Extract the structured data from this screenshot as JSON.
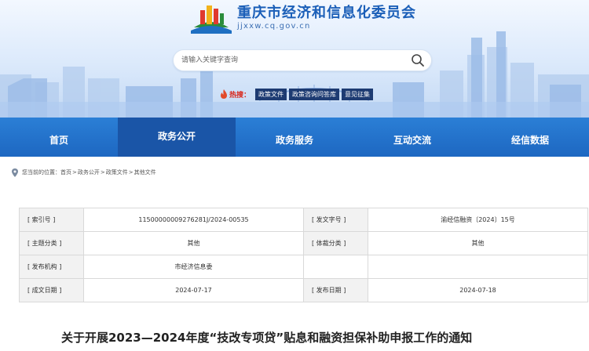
{
  "site": {
    "title": "重庆市经济和信息化委员会",
    "domain": "jjxxw.cq.gov.cn"
  },
  "search": {
    "placeholder": "请输入关键字查询"
  },
  "hot": {
    "label": "热搜：",
    "tags": [
      "政策文件",
      "政策咨询问答库",
      "意见征集"
    ]
  },
  "nav": {
    "items": [
      "首页",
      "政务公开",
      "政务服务",
      "互动交流",
      "经信数据"
    ],
    "active_index": 1
  },
  "breadcrumb": {
    "prefix": "您当前的位置：",
    "items": [
      "首页",
      "政务公开",
      "政策文件",
      "其他文件"
    ],
    "separator": ">"
  },
  "info_table": {
    "rows": [
      [
        {
          "label": "[ 索引号 ]",
          "value": "11500000009276281J/2024-00535"
        },
        {
          "label": "[ 发文字号 ]",
          "value": "渝经信融资〔2024〕15号"
        }
      ],
      [
        {
          "label": "[ 主题分类 ]",
          "value": "其他"
        },
        {
          "label": "[ 体裁分类 ]",
          "value": "其他"
        }
      ],
      [
        {
          "label": "[ 发布机构 ]",
          "value": "市经济信息委"
        },
        {
          "label": "",
          "value": ""
        }
      ],
      [
        {
          "label": "[ 成文日期 ]",
          "value": "2024-07-17"
        },
        {
          "label": "[ 发布日期 ]",
          "value": "2024-07-18"
        }
      ]
    ]
  },
  "article": {
    "title": "关于开展2023—2024年度“技改专项贷”贴息和融资担保补助申报工作的通知"
  },
  "colors": {
    "nav_bg": "#1d67c1",
    "nav_active": "#1a55a7",
    "title_blue": "#1b5fb8",
    "hot_red": "#d8281c",
    "tag_bg": "#1d3b72"
  },
  "icons": [
    "logo-emblem",
    "search-icon",
    "flame-icon",
    "location-pin-icon"
  ]
}
